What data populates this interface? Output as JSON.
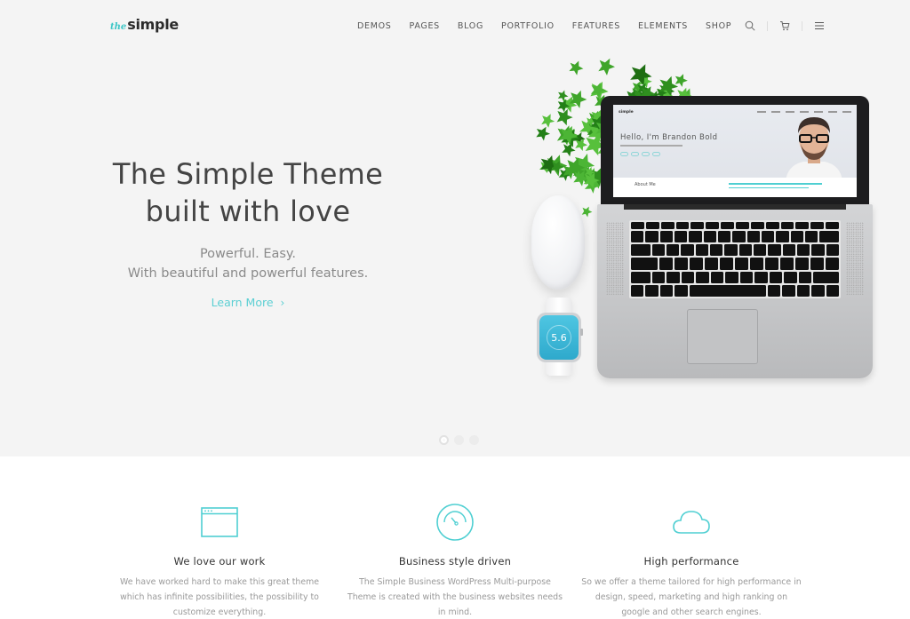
{
  "header": {
    "logo": {
      "prefix": "the",
      "name": "simple"
    },
    "nav": [
      {
        "label": "DEMOS"
      },
      {
        "label": "PAGES"
      },
      {
        "label": "BLOG"
      },
      {
        "label": "PORTFOLIO"
      },
      {
        "label": "FEATURES"
      },
      {
        "label": "ELEMENTS"
      },
      {
        "label": "SHOP"
      }
    ],
    "icons": [
      "search-icon",
      "cart-icon",
      "menu-icon"
    ]
  },
  "hero": {
    "title_line1": "The Simple Theme",
    "title_line2": "built with love",
    "subtitle_line1": "Powerful. Easy.",
    "subtitle_line2": "With beautiful and powerful features.",
    "cta_label": "Learn More",
    "cta_icon": "chevron-right-icon",
    "slides": {
      "count": 3,
      "active": 1
    },
    "laptop_screen": {
      "logo": "simple",
      "greeting": "Hello, I'm Brandon Bold",
      "section": "About Me"
    },
    "watch_value": "5.6"
  },
  "features": [
    {
      "icon": "browser-window-icon",
      "title": "We love our work",
      "text": "We have worked hard to make this great theme which has infinite possibilities, the possibility to customize everything."
    },
    {
      "icon": "speedometer-icon",
      "title": "Business style driven",
      "text": "The Simple Business WordPress Multi-purpose Theme is created with the business websites needs in mind."
    },
    {
      "icon": "cloud-icon",
      "title": "High performance",
      "text": "So we offer a theme tailored for high performance in design, speed, marketing and high ranking on google and other search engines."
    }
  ],
  "colors": {
    "accent": "#4fcfd2",
    "hero_bg": "#f4f4f4",
    "text_dark": "#444444",
    "text_muted": "#9a9a9a"
  }
}
